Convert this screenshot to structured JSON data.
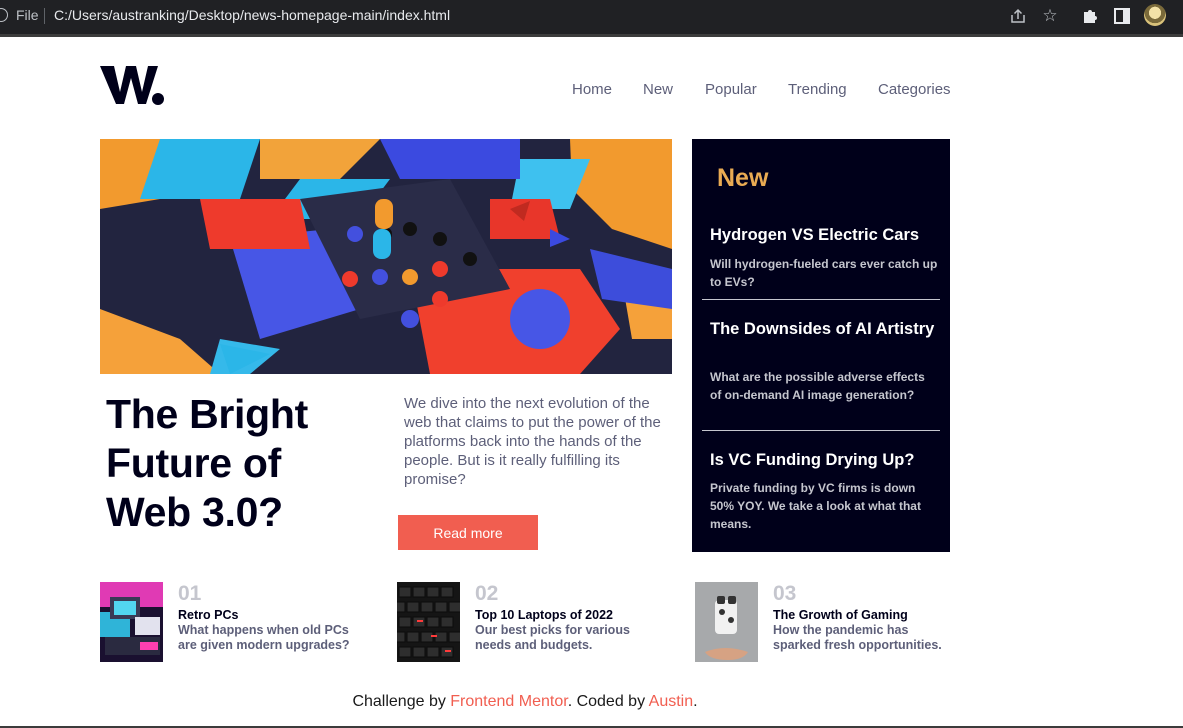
{
  "browser": {
    "file_label": "File",
    "url": "C:/Users/austranking/Desktop/news-homepage-main/index.html"
  },
  "brand": {
    "logo_text": "W."
  },
  "nav": {
    "items": [
      "Home",
      "New",
      "Popular",
      "Trending",
      "Categories"
    ]
  },
  "hero": {
    "title": "The Bright Future of Web 3.0?",
    "description": "We dive into the next evolution of the web that claims to put the power of the platforms back into the hands of the people. But is it really fulfilling its promise?",
    "cta": "Read more"
  },
  "new_panel": {
    "heading": "New",
    "items": [
      {
        "title": "Hydrogen VS Electric Cars",
        "desc": "Will hydrogen-fueled cars ever catch up to EVs?"
      },
      {
        "title": "The Downsides of AI Artistry",
        "desc": "What are the possible adverse effects of on-demand AI image generation?"
      },
      {
        "title": "Is VC Funding Drying Up?",
        "desc": "Private funding by VC firms is down 50% YOY. We take a look at what that means."
      }
    ]
  },
  "cards": [
    {
      "num": "01",
      "title": "Retro PCs",
      "desc": "What happens when old PCs are given modern upgrades?"
    },
    {
      "num": "02",
      "title": "Top 10 Laptops of 2022",
      "desc": "Our best picks for various needs and budgets."
    },
    {
      "num": "03",
      "title": "The Growth of Gaming",
      "desc": "How the pandemic has sparked fresh opportunities."
    }
  ],
  "footer": {
    "prefix": "Challenge by ",
    "link1": "Frontend Mentor",
    "middle": ". Coded by ",
    "link2": "Austin",
    "suffix": "."
  },
  "colors": {
    "accent_red": "#f15e50",
    "accent_orange": "#e9ab53",
    "dark_navy": "#00001a",
    "grayish_blue": "#5d5f79"
  }
}
